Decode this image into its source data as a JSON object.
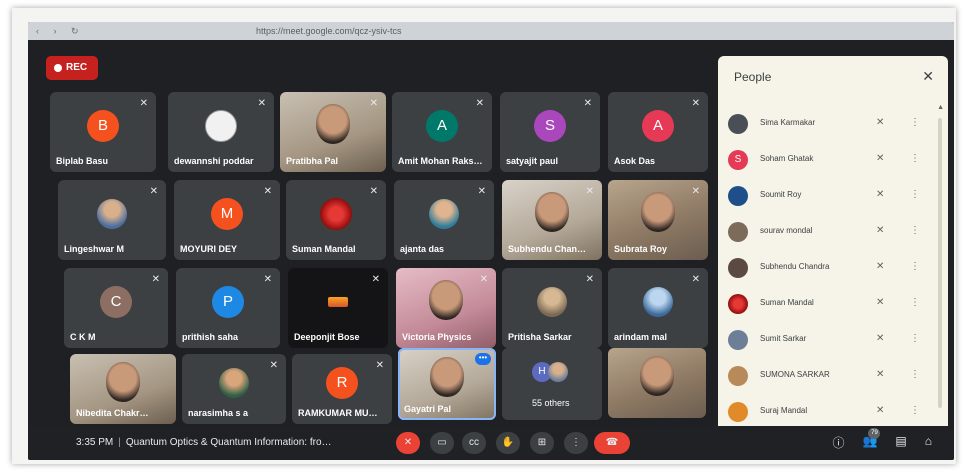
{
  "browser": {
    "url": "https://meet.google.com/qcz-ysiv-tcs",
    "nav": "‹ › ↻"
  },
  "rec_label": "REC",
  "colors": {
    "rec": "#c5221f",
    "end_call": "#ea4335",
    "tile": "#3c4043",
    "panel": "#f6f4e9"
  },
  "tiles": [
    {
      "name": "Biplab Basu",
      "avatar": "B",
      "color": "#f4511e"
    },
    {
      "name": "dewannshi poddar",
      "avatar": "",
      "color": "#ffffff"
    },
    {
      "name": "Pratibha Pal",
      "avatar": "",
      "color": ""
    },
    {
      "name": "Amit Mohan Raks…",
      "avatar": "A",
      "color": "#00796b"
    },
    {
      "name": "satyajit paul",
      "avatar": "S",
      "color": "#ab47bc"
    },
    {
      "name": "Asok Das",
      "avatar": "A",
      "color": "#e53955"
    },
    {
      "name": "Lingeshwar M",
      "avatar": "",
      "color": ""
    },
    {
      "name": "MOYURI DEY",
      "avatar": "M",
      "color": "#f4511e"
    },
    {
      "name": "Suman Mandal",
      "avatar": "",
      "color": "#b71c1c"
    },
    {
      "name": "ajanta das",
      "avatar": "",
      "color": ""
    },
    {
      "name": "Subhendu Chan…",
      "avatar": "",
      "color": ""
    },
    {
      "name": "Subrata Roy",
      "avatar": "",
      "color": ""
    },
    {
      "name": "C K M",
      "avatar": "C",
      "color": "#8d6e63"
    },
    {
      "name": "prithish saha",
      "avatar": "P",
      "color": "#1e88e5"
    },
    {
      "name": "Deeponjit Bose",
      "avatar": "",
      "color": ""
    },
    {
      "name": "Victoria Physics",
      "avatar": "",
      "color": ""
    },
    {
      "name": "Pritisha Sarkar",
      "avatar": "",
      "color": ""
    },
    {
      "name": "arindam mal",
      "avatar": "",
      "color": ""
    },
    {
      "name": "Nibedita Chakr…",
      "avatar": "",
      "color": ""
    },
    {
      "name": "narasimha s a",
      "avatar": "",
      "color": ""
    },
    {
      "name": "RAMKUMAR MU…",
      "avatar": "R",
      "color": "#f4511e"
    },
    {
      "name": "Gayatri Pal",
      "avatar": "",
      "color": ""
    },
    {
      "name": "55 others",
      "avatar": "H",
      "color": "#5c6bc0"
    },
    {
      "name": "",
      "avatar": "",
      "color": ""
    }
  ],
  "bottom_bar": {
    "time": "3:35 PM",
    "separator": "|",
    "meeting_title": "Quantum Optics & Quantum Information: fro…",
    "participant_count": "79"
  },
  "people_panel": {
    "title": "People",
    "close": "✕",
    "people": [
      {
        "name": "Sima Karmakar",
        "avatar": "",
        "color": "#4a4e55"
      },
      {
        "name": "Soham Ghatak",
        "avatar": "S",
        "color": "#e53955"
      },
      {
        "name": "Soumit Roy",
        "avatar": "",
        "color": "#1e4f8a"
      },
      {
        "name": "sourav mondal",
        "avatar": "",
        "color": "#7d6b5a"
      },
      {
        "name": "Subhendu Chandra",
        "avatar": "",
        "color": "#5a4a42"
      },
      {
        "name": "Suman Mandal",
        "avatar": "",
        "color": "#b71c1c"
      },
      {
        "name": "Sumit Sarkar",
        "avatar": "",
        "color": "#6d7f96"
      },
      {
        "name": "SUMONA SARKAR",
        "avatar": "",
        "color": "#b88a5a"
      },
      {
        "name": "Suraj Mandal",
        "avatar": "",
        "color": "#e08a2a"
      }
    ]
  }
}
